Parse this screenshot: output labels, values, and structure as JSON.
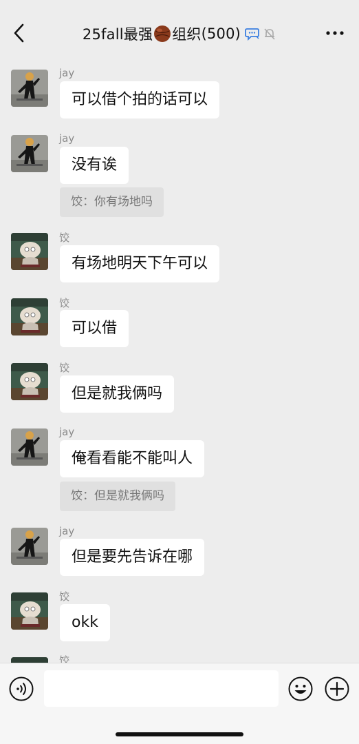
{
  "header": {
    "title_prefix": "25fall最强",
    "title_suffix": "组织",
    "member_count": "(500)",
    "icons": [
      "back-icon",
      "basketball-icon",
      "chat-bubble-icon",
      "mute-bell-icon",
      "more-icon"
    ]
  },
  "messages": [
    {
      "sender": "jay",
      "text": "可以借个拍的话可以",
      "avatar": "jay-avatar"
    },
    {
      "sender": "jay",
      "text": "没有诶",
      "avatar": "jay-avatar",
      "quote": "饺：你有场地吗"
    },
    {
      "sender": "饺",
      "text": "有场地明天下午可以",
      "avatar": "jiao-avatar"
    },
    {
      "sender": "饺",
      "text": "可以借",
      "avatar": "jiao-avatar"
    },
    {
      "sender": "饺",
      "text": "但是就我俩吗",
      "avatar": "jiao-avatar"
    },
    {
      "sender": "jay",
      "text": "俺看看能不能叫人",
      "avatar": "jay-avatar",
      "quote": "饺：但是就我俩吗"
    },
    {
      "sender": "jay",
      "text": "但是要先告诉在哪",
      "avatar": "jay-avatar"
    },
    {
      "sender": "饺",
      "text": "okk",
      "avatar": "jiao-avatar"
    },
    {
      "sender": "饺",
      "text": "",
      "avatar": "jiao-avatar"
    }
  ],
  "input": {
    "placeholder": "",
    "icons": [
      "voice-icon",
      "emoji-icon",
      "plus-icon"
    ]
  }
}
